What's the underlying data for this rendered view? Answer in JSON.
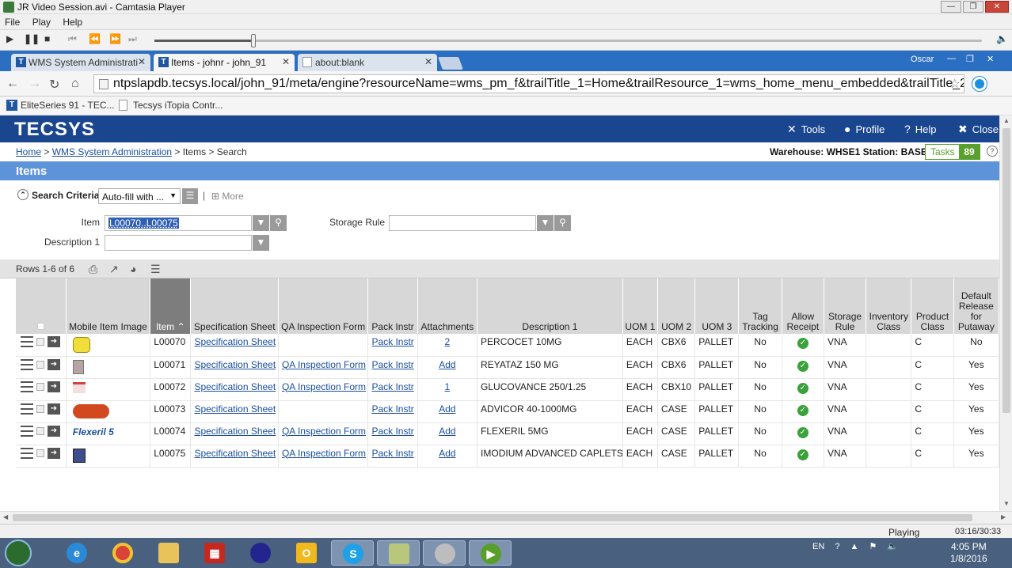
{
  "player": {
    "title": "JR Video Session.avi - Camtasia Player",
    "menu": [
      "File",
      "Play",
      "Help"
    ],
    "progress": 0.12,
    "controls": [
      "play-icon",
      "pause-icon",
      "stop-icon",
      "skip-start-icon",
      "rewind-icon",
      "forward-icon",
      "skip-end-icon",
      "volume-icon"
    ],
    "status": "Playing",
    "time": "03:16/30:33"
  },
  "browser": {
    "tabs": [
      {
        "label": "WMS System Administrati",
        "icon": "tecsys-icon"
      },
      {
        "label": "Items - johnr - john_91",
        "icon": "tecsys-icon"
      },
      {
        "label": "about:blank",
        "icon": "page-icon"
      }
    ],
    "user": "Oscar",
    "url": "ntpslapdb.tecsys.local/john_91/meta/engine?resourceName=wms_pm_f&trailTitle_1=Home&trailResource_1=wms_home_menu_embedded&trailTitle_2=WMS+",
    "bookmarks": [
      "EliteSeries 91 - TEC...",
      "Tecsys iTopia Contr..."
    ]
  },
  "app": {
    "logo": "TECSYS",
    "header_buttons": [
      "Tools",
      "Profile",
      "Help",
      "Close"
    ],
    "breadcrumb": {
      "home": "Home",
      "sep1": " > ",
      "wms": "WMS System Administration",
      "rest": " > Items > Search"
    },
    "warehouse": "Warehouse: WHSE1  Station: BASE",
    "tasks_label": "Tasks",
    "tasks_count": "89",
    "section_title": "Items",
    "search": {
      "criteria_label": "Search Criteria",
      "autofill": "Auto-fill with ...",
      "more": "More",
      "item_label": "Item",
      "item_value": "L00070..L00075",
      "storage_label": "Storage Rule",
      "desc_label": "Description 1"
    },
    "rows_label": "Rows 1-6 of 6"
  },
  "grid": {
    "columns": [
      "",
      "Mobile Item Image",
      "Item",
      "Specification Sheet",
      "QA Inspection Form",
      "Pack Instr",
      "Attachments",
      "Description 1",
      "UOM 1",
      "UOM 2",
      "UOM 3",
      "Tag Tracking",
      "Allow Receipt",
      "Storage Rule",
      "Inventory Class",
      "Product Class",
      "Default Release for Putaway"
    ],
    "rows": [
      {
        "item": "L00070",
        "spec": "Specification Sheet",
        "qa": "",
        "pack": "Pack Instr",
        "att": "2",
        "desc": "PERCOCET 10MG",
        "uom1": "EACH",
        "uom2": "CBX6",
        "uom3": "PALLET",
        "tag": "No",
        "storage": "VNA",
        "inv": "",
        "prod": "C",
        "release": "No",
        "image": "yellow-pill"
      },
      {
        "item": "L00071",
        "spec": "Specification Sheet",
        "qa": "QA Inspection Form",
        "pack": "Pack Instr",
        "att": "Add",
        "desc": "REYATAZ 150 MG",
        "uom1": "EACH",
        "uom2": "CBX6",
        "uom3": "PALLET",
        "tag": "No",
        "storage": "VNA",
        "inv": "",
        "prod": "C",
        "release": "Yes",
        "image": "bottle"
      },
      {
        "item": "L00072",
        "spec": "Specification Sheet",
        "qa": "QA Inspection Form",
        "pack": "Pack Instr",
        "att": "1",
        "desc": "GLUCOVANCE 250/1.25",
        "uom1": "EACH",
        "uom2": "CBX10",
        "uom3": "PALLET",
        "tag": "No",
        "storage": "VNA",
        "inv": "",
        "prod": "C",
        "release": "Yes",
        "image": "box"
      },
      {
        "item": "L00073",
        "spec": "Specification Sheet",
        "qa": "",
        "pack": "Pack Instr",
        "att": "Add",
        "desc": "ADVICOR 40-1000MG",
        "uom1": "EACH",
        "uom2": "CASE",
        "uom3": "PALLET",
        "tag": "No",
        "storage": "VNA",
        "inv": "",
        "prod": "C",
        "release": "Yes",
        "image": "red-pill"
      },
      {
        "item": "L00074",
        "spec": "Specification Sheet",
        "qa": "QA Inspection Form",
        "pack": "Pack Instr",
        "att": "Add",
        "desc": "FLEXERIL 5MG",
        "uom1": "EACH",
        "uom2": "CASE",
        "uom3": "PALLET",
        "tag": "No",
        "storage": "VNA",
        "inv": "",
        "prod": "C",
        "release": "Yes",
        "image": "flexeril-logo"
      },
      {
        "item": "L00075",
        "spec": "Specification Sheet",
        "qa": "QA Inspection Form",
        "pack": "Pack Instr",
        "att": "Add",
        "desc": "IMODIUM ADVANCED CAPLETS",
        "uom1": "EACH",
        "uom2": "CASE",
        "uom3": "PALLET",
        "tag": "No",
        "storage": "VNA",
        "inv": "",
        "prod": "C",
        "release": "Yes",
        "image": "package"
      }
    ]
  },
  "taskbar": {
    "lang": "EN",
    "time": "4:05 PM",
    "date": "1/8/2016",
    "apps": [
      "ie-icon",
      "chrome-icon",
      "explorer-icon",
      "app-grid-icon",
      "globe-icon",
      "outlook-icon",
      "skype-icon",
      "notes-icon",
      "disc-icon",
      "camtasia-icon"
    ]
  },
  "colors": {
    "header": "#1a4690",
    "section": "#5d93d9",
    "link": "#1a4fa0",
    "tasks": "#5aa02c",
    "ok": "#3aa23a"
  }
}
